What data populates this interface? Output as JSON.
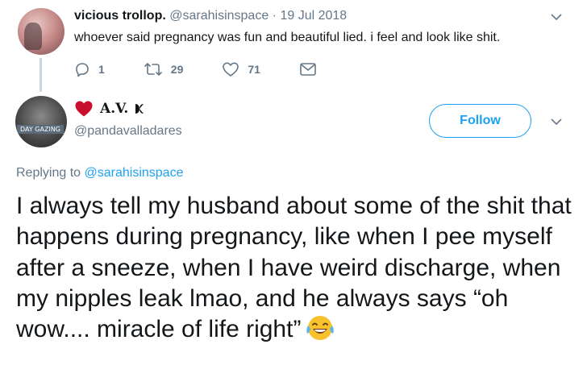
{
  "parent_tweet": {
    "display_name": "vicious trollop.",
    "handle": "@sarahisinspace",
    "separator": "·",
    "date": "19 Jul 2018",
    "text": "whoever said pregnancy was fun and beautiful lied. i feel and look like shit.",
    "actions": {
      "replies": "1",
      "retweets": "29",
      "likes": "71"
    }
  },
  "reply_tweet": {
    "display_name": "A.V.",
    "handle": "@pandavalladares",
    "avatar_tag": "DAY GAZING",
    "follow_label": "Follow",
    "replying_prefix": "Replying to",
    "replying_to": "@sarahisinspace",
    "body": "I always tell my husband about some of the shit that happens during pregnancy, like when I pee myself after a sneeze, when I have weird discharge, when my nipples leak lmao, and he always says “oh wow.... miracle of life right”"
  },
  "colors": {
    "accent": "#1da1f2",
    "muted": "#657786",
    "heart": "#e0245e"
  }
}
